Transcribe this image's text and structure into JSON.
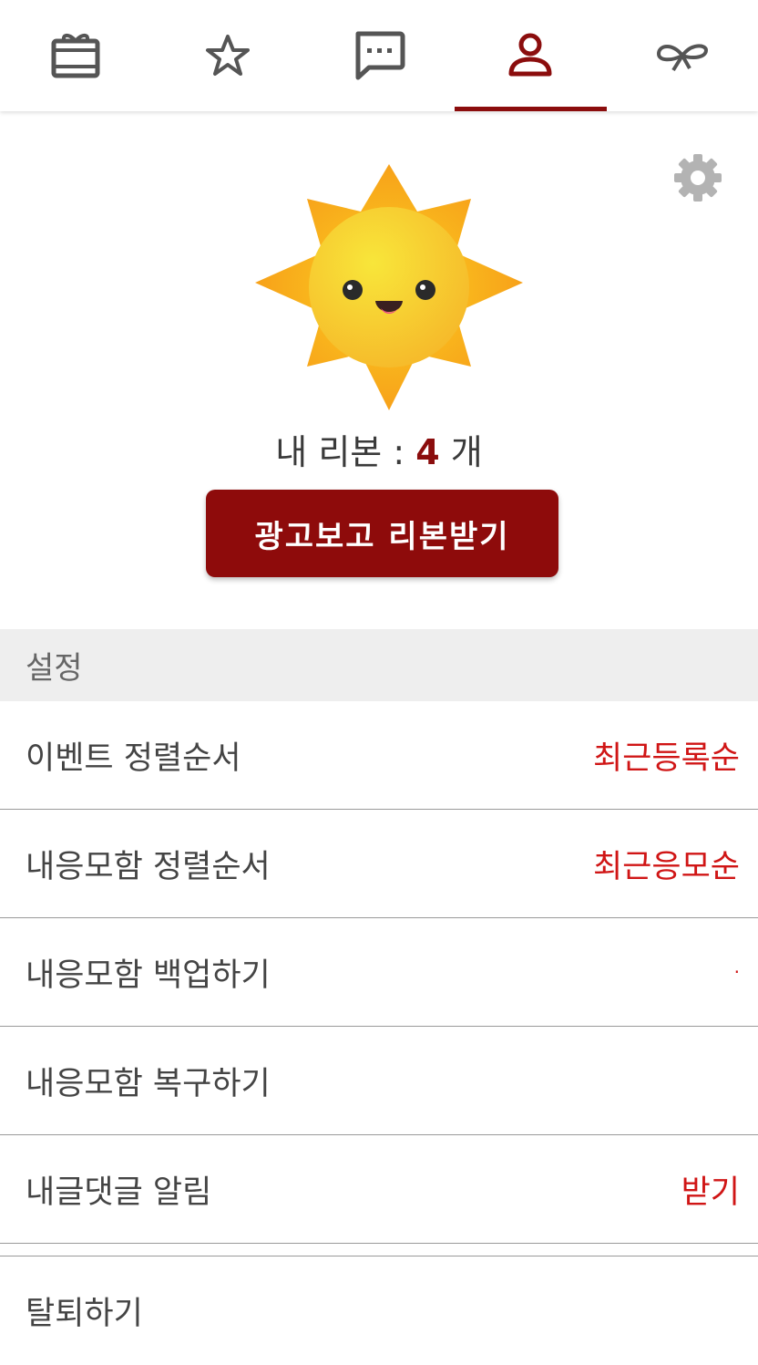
{
  "tabs": [
    {
      "name": "gift-tab",
      "icon": "gift-card-icon",
      "active": false
    },
    {
      "name": "favorites-tab",
      "icon": "star-icon",
      "active": false
    },
    {
      "name": "chat-tab",
      "icon": "chat-bubble-icon",
      "active": false
    },
    {
      "name": "profile-tab",
      "icon": "person-icon",
      "active": true
    },
    {
      "name": "ribbon-tab",
      "icon": "ribbon-icon",
      "active": false
    }
  ],
  "profile": {
    "ribbon_label": "내 리본 : ",
    "ribbon_count": "4",
    "ribbon_unit": " 개",
    "ad_button_label": "광고보고 리본받기",
    "avatar_icon": "sun-mascot-icon",
    "settings_icon": "gear-icon"
  },
  "settings": {
    "header": "설정",
    "rows": [
      {
        "label": "이벤트 정렬순서",
        "value": "최근등록순"
      },
      {
        "label": "내응모함 정렬순서",
        "value": "최근응모순"
      },
      {
        "label": "내응모함 백업하기",
        "value": "·"
      },
      {
        "label": "내응모함 복구하기",
        "value": ""
      },
      {
        "label": "내글댓글 알림",
        "value": "받기"
      }
    ],
    "withdraw_label": "탈퇴하기"
  },
  "colors": {
    "accent": "#8e0b0b",
    "value_red": "#d01515",
    "icon_gray": "#555555",
    "section_bg": "#eeeeee"
  }
}
